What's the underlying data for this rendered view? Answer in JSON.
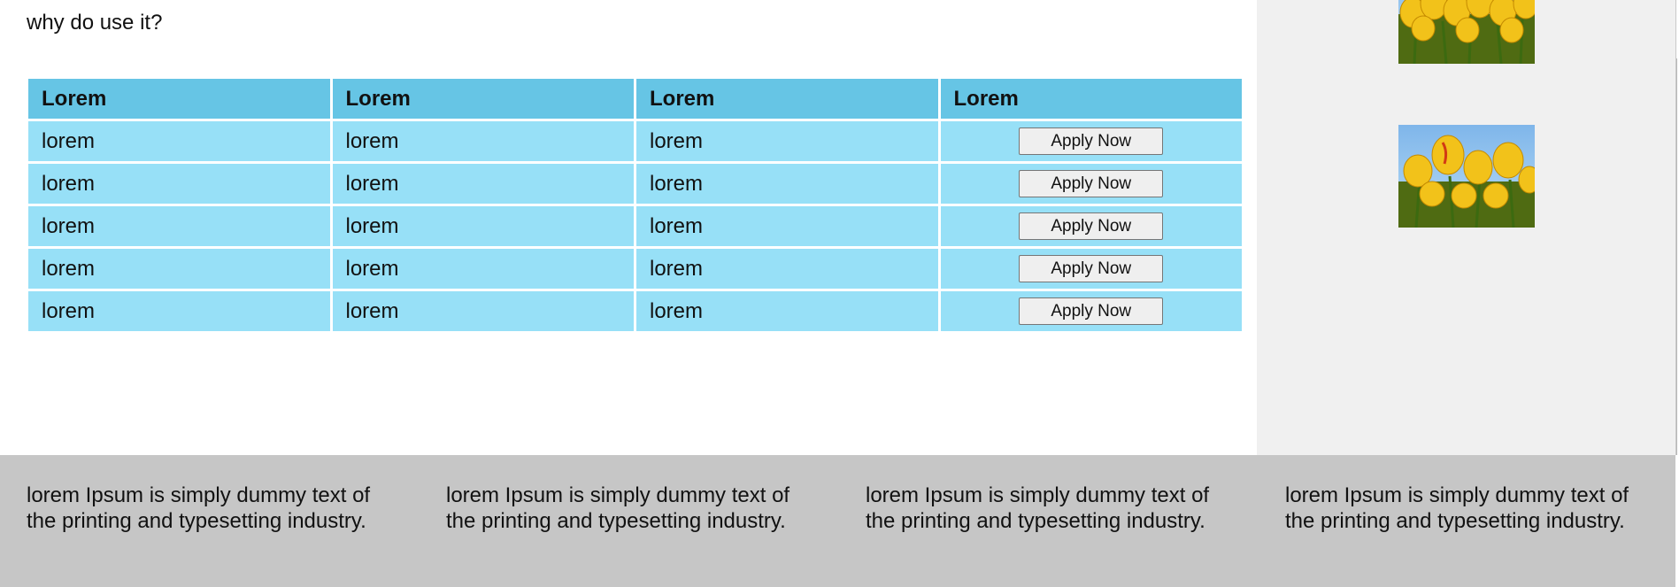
{
  "main": {
    "intro_text": "why do use it?",
    "table": {
      "headers": [
        "Lorem",
        "Lorem",
        "Lorem",
        "Lorem"
      ],
      "rows": [
        {
          "cells": [
            "lorem",
            "lorem",
            "lorem"
          ],
          "button": "Apply Now"
        },
        {
          "cells": [
            "lorem",
            "lorem",
            "lorem"
          ],
          "button": "Apply Now"
        },
        {
          "cells": [
            "lorem",
            "lorem",
            "lorem"
          ],
          "button": "Apply Now"
        },
        {
          "cells": [
            "lorem",
            "lorem",
            "lorem"
          ],
          "button": "Apply Now"
        },
        {
          "cells": [
            "lorem",
            "lorem",
            "lorem"
          ],
          "button": "Apply Now"
        }
      ]
    },
    "colors": {
      "header_bg": "#66c5e5",
      "row_bg": "#97e0f7"
    }
  },
  "sidebar": {
    "images": [
      "tulips-image",
      "tulips-image"
    ],
    "background": "#f0f0f0"
  },
  "footer": {
    "columns": [
      "lorem Ipsum is simply dummy text of the printing and typesetting industry.",
      "lorem Ipsum is simply dummy text of the printing and typesetting industry.",
      "lorem Ipsum is simply dummy text of the printing and typesetting industry.",
      "lorem Ipsum is simply dummy text of the printing and typesetting industry."
    ],
    "background": "#c6c6c6"
  }
}
